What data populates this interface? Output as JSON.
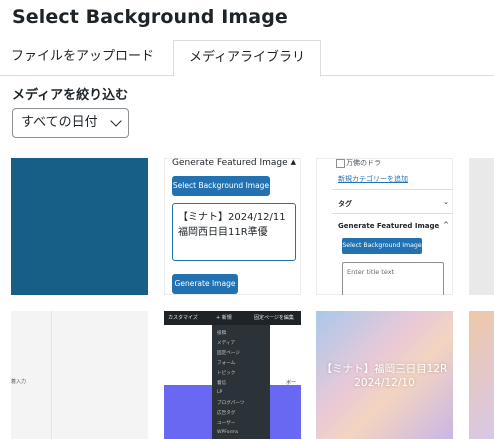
{
  "title": "Select Background Image",
  "tabs": [
    {
      "label": "ファイルをアップロード"
    },
    {
      "label": "メディアライブラリ"
    }
  ],
  "filter": {
    "label": "メディアを絞り込む",
    "date_value": "すべての日付"
  },
  "tiles": {
    "tile1": {
      "color": "#185f88"
    },
    "tile2": {
      "header": "Generate Featured Image",
      "select_button": "Select Background Image",
      "textarea_line1": "【ミナト】2024/12/11",
      "textarea_line2": "福岡西日目11R準優",
      "generate_button": "Generate Image"
    },
    "tile3": {
      "checkbox_label": "万佛のドラ",
      "add_category_link": "新規カテゴリーを追加",
      "tag_section": "タグ",
      "gen_section": "Generate Featured Image",
      "select_button": "Select Background Image",
      "input_placeholder": "Enter title text"
    },
    "tile5": {
      "label": "着入力"
    },
    "tile6": {
      "bar_customize": "カスタマイズ",
      "bar_new": "+ 新規",
      "bar_edit": "固定ページを編集",
      "menu_items": [
        "投稿",
        "メディア",
        "固定ページ",
        "フォーム",
        "トピック",
        "着信",
        "LP",
        "ブログパーツ",
        "広告タグ",
        "ユーザー",
        "WPForms"
      ],
      "side_text": "ボー"
    },
    "tile7": {
      "line1": "【ミナト】福岡三日目12R",
      "line2": "2024/12/10"
    }
  }
}
